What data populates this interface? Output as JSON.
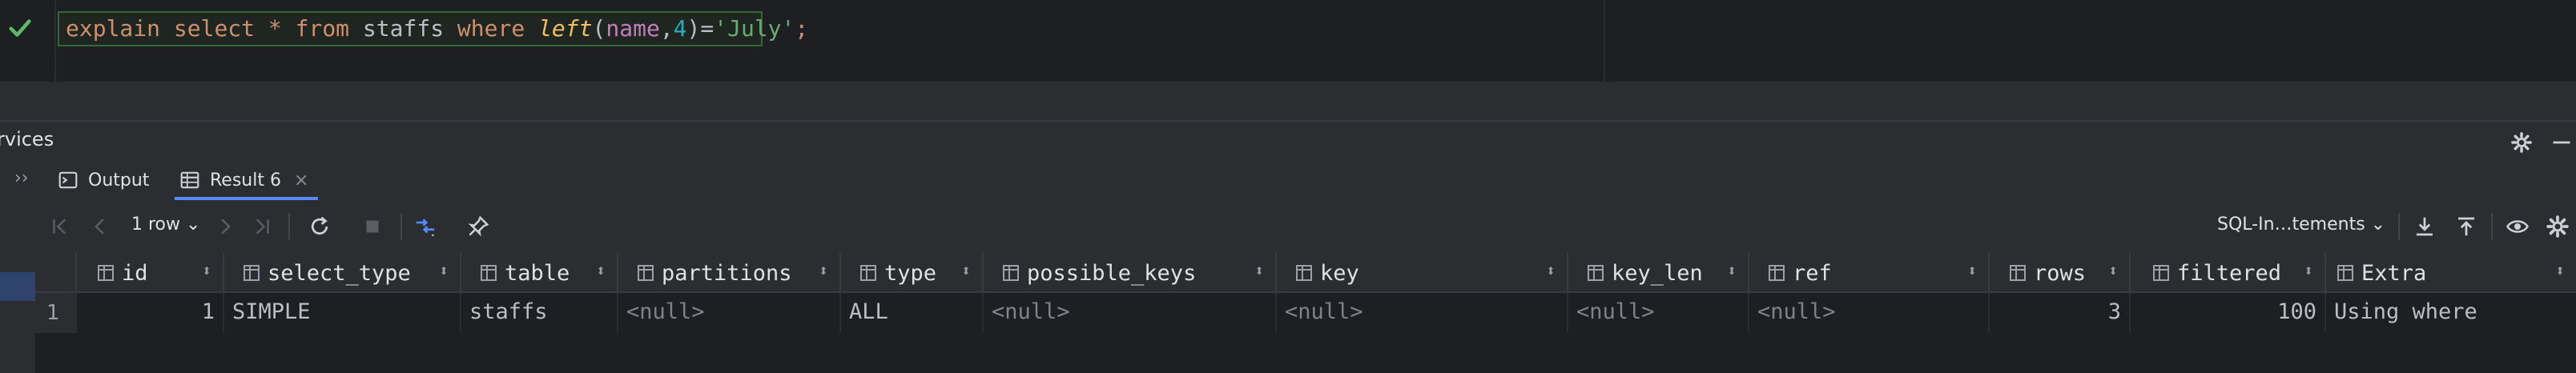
{
  "editor": {
    "sql_tokens": {
      "t1": "explain",
      "t2": "select",
      "t3": "*",
      "t4": "from",
      "t5": "staffs",
      "t6": "where",
      "t7": "left",
      "t8": "(",
      "t9": "name",
      "t10": ",",
      "t11": "4",
      "t12": ")",
      "t13": "=",
      "t14": "'July'",
      "t15": ";"
    },
    "status_icon": "check-icon"
  },
  "services": {
    "title": "rvices"
  },
  "tabs": [
    {
      "label": "Output",
      "icon": "output-icon"
    },
    {
      "label": "Result 6",
      "icon": "table-icon",
      "active": true
    }
  ],
  "toolbar": {
    "rows_label": "1 row ⌄",
    "sql_insert_label": "SQL-In…tements ⌄"
  },
  "grid": {
    "columns": [
      {
        "name": "id"
      },
      {
        "name": "select_type"
      },
      {
        "name": "table"
      },
      {
        "name": "partitions"
      },
      {
        "name": "type"
      },
      {
        "name": "possible_keys"
      },
      {
        "name": "key"
      },
      {
        "name": "key_len"
      },
      {
        "name": "ref"
      },
      {
        "name": "rows"
      },
      {
        "name": "filtered"
      },
      {
        "name": "Extra"
      }
    ],
    "rows": [
      {
        "row_number": "1",
        "cells": [
          "1",
          "SIMPLE",
          "staffs",
          "<null>",
          "ALL",
          "<null>",
          "<null>",
          "<null>",
          "<null>",
          "3",
          "100",
          "Using where"
        ]
      }
    ]
  },
  "colors": {
    "accent": "#548af7",
    "keyword": "#cf8e6d",
    "string": "#6aab73",
    "number": "#2aacb8",
    "success": "#5fb865"
  }
}
